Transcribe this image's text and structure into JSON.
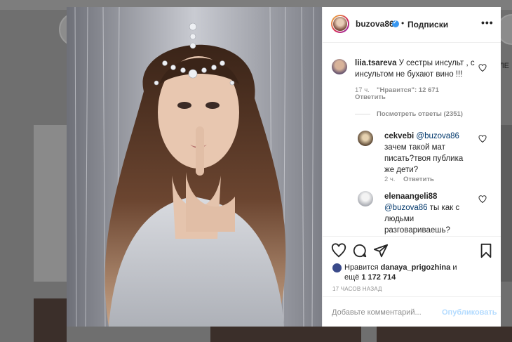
{
  "post": {
    "username": "buzova86",
    "dot": "•",
    "follow_state": "Подписки",
    "more": "•••"
  },
  "comments": [
    {
      "user": "liia.tsareva",
      "text": "У сестры инсульт , с инсультом не бухают вино !!!",
      "time": "17 ч.",
      "likes": "\"Нравится\": 12 671",
      "reply": "Ответить",
      "view_replies": "Посмотреть ответы (2351)",
      "replies": [
        {
          "user": "cekvebi",
          "mention": "@buzova86",
          "text": "зачем такой мат писать?твоя публика же дети?",
          "time": "2 ч.",
          "reply": "Ответить"
        },
        {
          "user": "elenaangeli88",
          "mention": "@buzova86",
          "text": "ты как с людьми разговариваешь?"
        }
      ]
    }
  ],
  "likes": {
    "prefix": "Нравится",
    "user": "danaya_prigozhina",
    "mid": "и",
    "count_prefix": "ещё",
    "count": "1 172 714"
  },
  "time_ago": "17 ЧАСОВ НАЗАД",
  "comment_input": {
    "placeholder": "Добавьте комментарий...",
    "post_label": "Опубликовать"
  },
  "background": {
    "side_label": "л ЛЕ"
  },
  "colors": {
    "verified": "#3897f0",
    "post_button": "#b3dbff",
    "mention": "#00376b"
  }
}
